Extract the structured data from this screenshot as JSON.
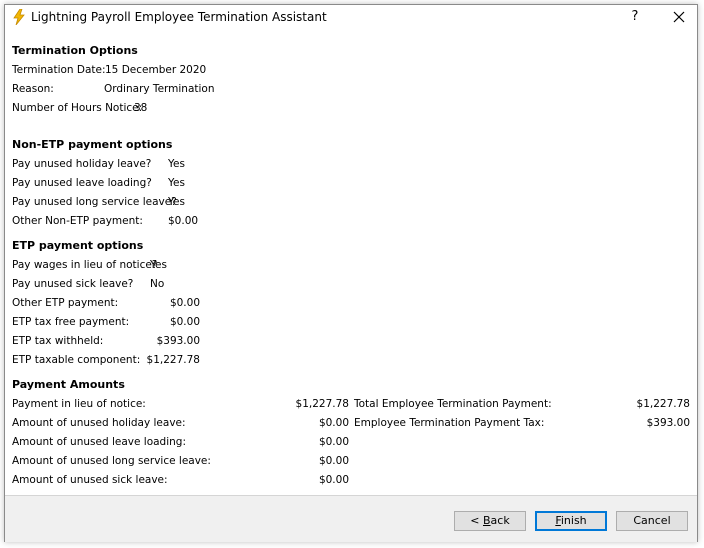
{
  "window": {
    "title": "Lightning Payroll Employee Termination Assistant",
    "help_label": "?",
    "accent_color": "#0078d7",
    "icon_color": "#f2b705"
  },
  "termination_options": {
    "heading": "Termination Options",
    "date_label": "Termination Date:",
    "date_value": "15 December 2020",
    "reason_label": "Reason:",
    "reason_value": "Ordinary Termination",
    "hours_label": "Number of Hours Notice:",
    "hours_value": "38"
  },
  "non_etp": {
    "heading": "Non-ETP payment options",
    "rows": [
      {
        "label": "Pay unused holiday leave?",
        "value": "Yes"
      },
      {
        "label": "Pay unused leave loading?",
        "value": "Yes"
      },
      {
        "label": "Pay unused long service leave?",
        "value": "Yes"
      },
      {
        "label": "Other Non-ETP payment:",
        "value": "$0.00"
      }
    ]
  },
  "etp": {
    "heading": "ETP payment options",
    "rows": [
      {
        "label": "Pay wages in lieu of notice?",
        "value": "Yes"
      },
      {
        "label": "Pay unused sick leave?",
        "value": "No"
      },
      {
        "label": "Other ETP payment:",
        "value": "$0.00"
      },
      {
        "label": "ETP tax free payment:",
        "value": "$0.00"
      },
      {
        "label": "ETP tax withheld:",
        "value": "$393.00"
      },
      {
        "label": "ETP taxable component:",
        "value": "$1,227.78"
      }
    ]
  },
  "payment_amounts": {
    "heading": "Payment Amounts",
    "left": [
      {
        "label": "Payment in lieu of notice:",
        "value": "$1,227.78"
      },
      {
        "label": "Amount of unused holiday leave:",
        "value": "$0.00"
      },
      {
        "label": "Amount of unused leave loading:",
        "value": "$0.00"
      },
      {
        "label": "Amount of unused long service leave:",
        "value": "$0.00"
      },
      {
        "label": "Amount of unused sick leave:",
        "value": "$0.00"
      }
    ],
    "right": [
      {
        "label": "Total Employee Termination Payment:",
        "value": "$1,227.78"
      },
      {
        "label": "Employee Termination Payment Tax:",
        "value": "$393.00"
      }
    ]
  },
  "buttons": {
    "back_prefix": "< ",
    "back_mnemonic": "B",
    "back_rest": "ack",
    "finish_mnemonic": "F",
    "finish_rest": "inish",
    "cancel": "Cancel"
  }
}
